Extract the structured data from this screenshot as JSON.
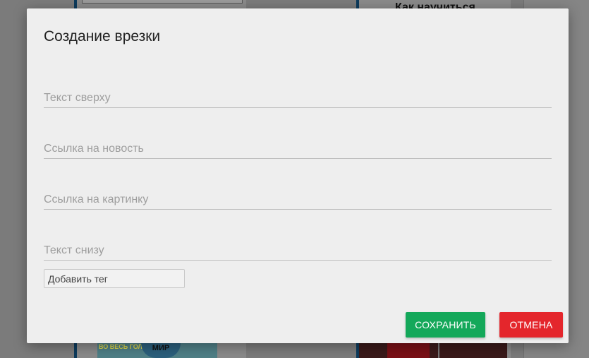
{
  "background": {
    "heading_fragment": "Как научиться",
    "left_image_text": "МИР",
    "left_image_caption": "ВО ВЕСЬ ГОЛОС"
  },
  "dialog": {
    "title": "Создание врезки",
    "fields": {
      "top_text_placeholder": "Текст сверху",
      "news_link_placeholder": "Ссылка на новость",
      "image_link_placeholder": "Ссылка на картинку",
      "bottom_text_placeholder": "Текст снизу"
    },
    "tag_placeholder": "Добавить тег",
    "save_label": "СОХРАНИТЬ",
    "cancel_label": "ОТМЕНА"
  },
  "colors": {
    "save": "#14a85a",
    "cancel": "#e4262c",
    "dialog_bg": "#eeeeee"
  }
}
